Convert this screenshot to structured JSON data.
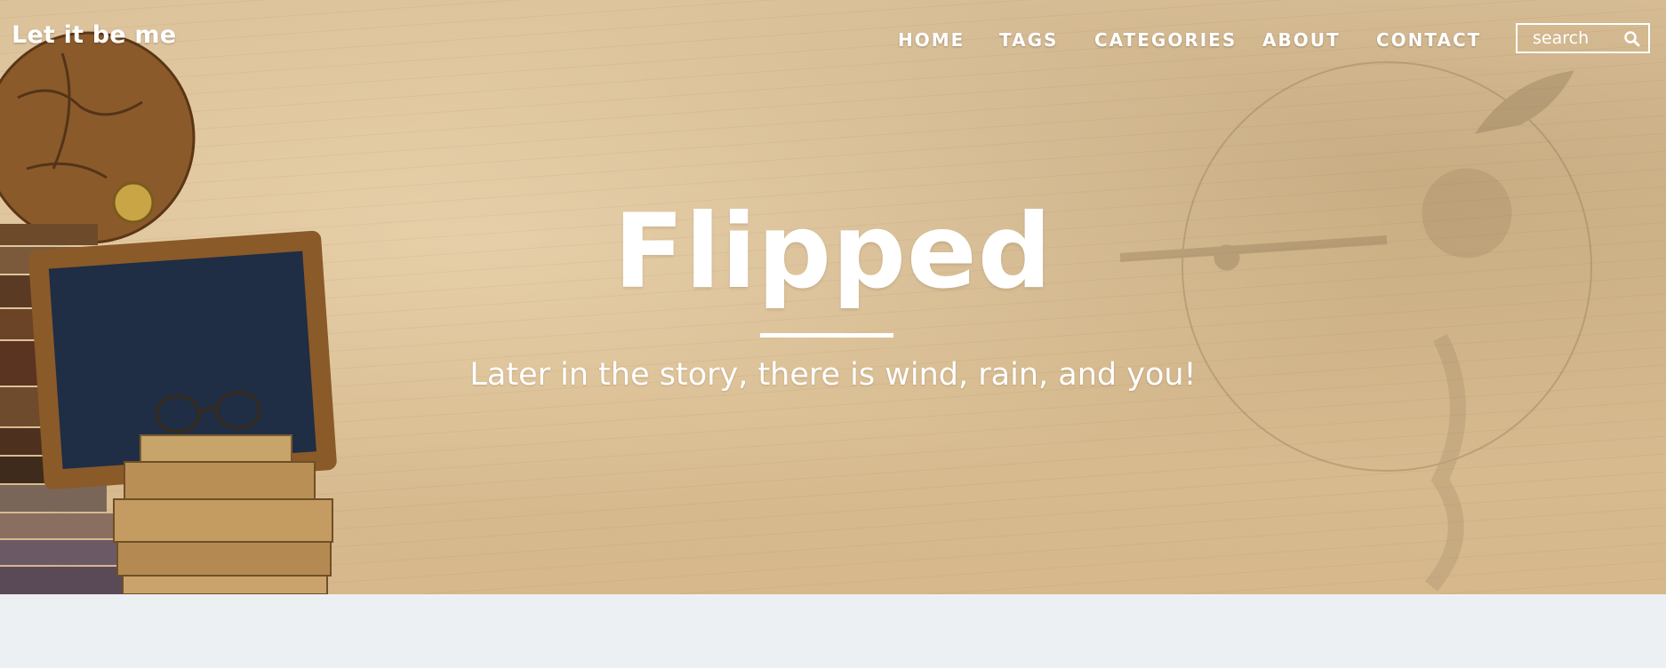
{
  "site": {
    "brand": "Let it be me"
  },
  "nav": {
    "items": [
      {
        "label": "HOME"
      },
      {
        "label": "TAGS"
      },
      {
        "label": "CATEGORIES"
      },
      {
        "label": "ABOUT"
      },
      {
        "label": "CONTACT"
      }
    ]
  },
  "search": {
    "placeholder": "search",
    "icon": "search-icon"
  },
  "hero": {
    "title": "Flipped",
    "subtitle": "Later in the story, there is wind, rain, and you!"
  },
  "colors": {
    "hero_background": "#d9bd92",
    "page_background": "#edf0f3",
    "text": "#ffffff"
  }
}
